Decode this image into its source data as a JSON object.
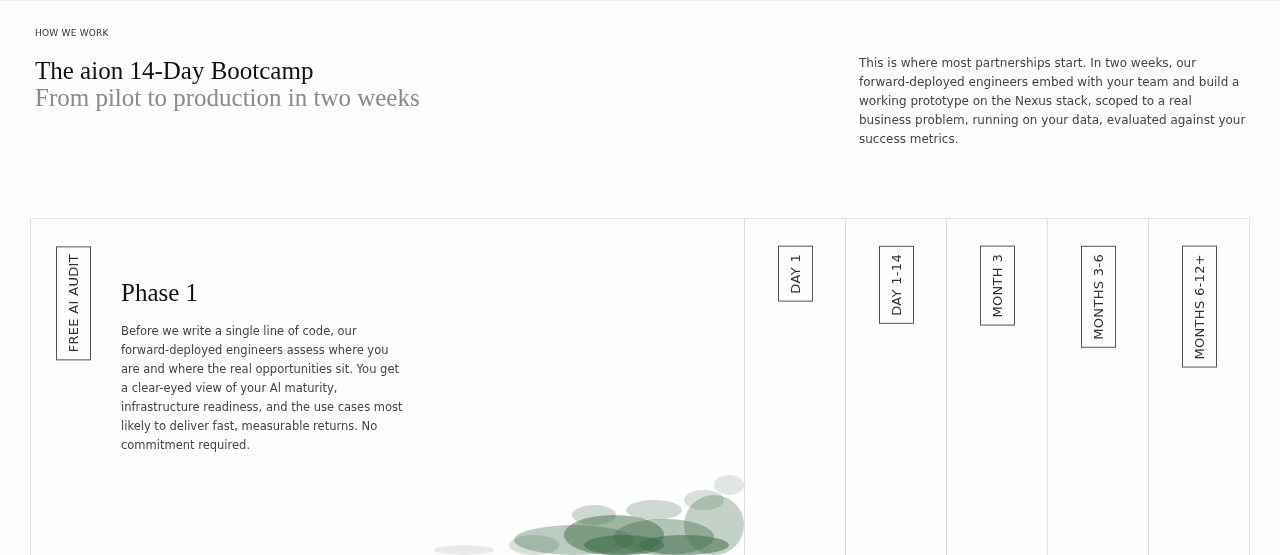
{
  "eyebrow": "HOW WE WORK",
  "title": "The aion 14-Day Bootcamp",
  "subtitle": "From pilot to production in two weeks",
  "intro": "This is where most partnerships start. In two weeks, our forward-deployed engineers embed with your team and build a working prototype on the Nexus stack, scoped to a real business problem, running on your data, evaluated against your success metrics.",
  "phases": [
    {
      "label": "FREE AI AUDIT",
      "expanded": true,
      "title": "Phase 1",
      "description": "Before we write a single line of code, our forward-deployed engineers assess where you are and where the real opportunities sit. You get a clear-eyed view of your Al maturity, infrastructure readiness, and the use cases most likely to deliver fast, measurable returns. No commitment required.",
      "kind": "picture"
    },
    {
      "label": "DAY 1",
      "expanded": false
    },
    {
      "label": "DAY 1-14",
      "expanded": false
    },
    {
      "label": "MONTH 3",
      "expanded": false
    },
    {
      "label": "MONTHS 3-6",
      "expanded": false
    },
    {
      "label": "MONTHS 6-12+",
      "expanded": false
    }
  ]
}
